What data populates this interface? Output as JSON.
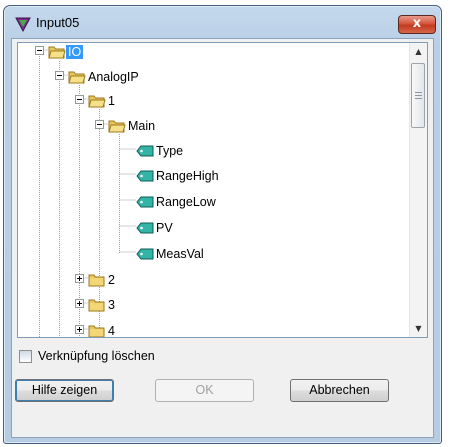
{
  "window": {
    "title": "Input05",
    "close_label": "x"
  },
  "tree": {
    "nodes": [
      {
        "label": "IO",
        "kind": "folder-open",
        "expander": "minus",
        "selected": true
      },
      {
        "label": "AnalogIP",
        "kind": "folder-open",
        "expander": "minus"
      },
      {
        "label": "1",
        "kind": "folder-open",
        "expander": "minus"
      },
      {
        "label": "Main",
        "kind": "folder-open",
        "expander": "minus"
      },
      {
        "label": "Type",
        "kind": "tag"
      },
      {
        "label": "RangeHigh",
        "kind": "tag"
      },
      {
        "label": "RangeLow",
        "kind": "tag"
      },
      {
        "label": "PV",
        "kind": "tag"
      },
      {
        "label": "MeasVal",
        "kind": "tag"
      },
      {
        "label": "2",
        "kind": "folder",
        "expander": "plus"
      },
      {
        "label": "3",
        "kind": "folder",
        "expander": "plus"
      },
      {
        "label": "4",
        "kind": "folder",
        "expander": "plus"
      }
    ]
  },
  "options": {
    "delete_link_label": "Verknüpfung löschen",
    "delete_link_checked": false
  },
  "buttons": {
    "help": "Hilfe zeigen",
    "ok": "OK",
    "cancel": "Abbrechen"
  },
  "colors": {
    "selection": "#3399ff",
    "title_bar": "#b9cfe6",
    "close_button": "#c13a1f"
  }
}
